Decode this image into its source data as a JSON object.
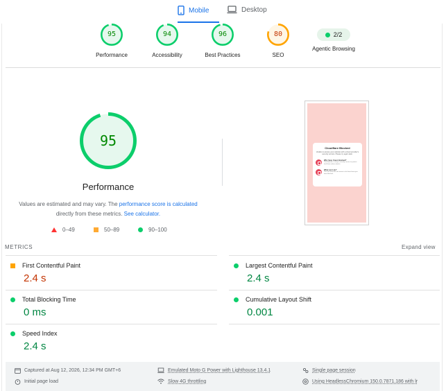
{
  "tabs": {
    "mobile": "Mobile",
    "desktop": "Desktop"
  },
  "categories": [
    {
      "score": "95",
      "label": "Performance",
      "color": "#0cce6b",
      "text_color": "#008800",
      "bg": "#e6f8ee",
      "value": 95
    },
    {
      "score": "94",
      "label": "Accessibility",
      "color": "#0cce6b",
      "text_color": "#008800",
      "bg": "#e6f8ee",
      "value": 94
    },
    {
      "score": "96",
      "label": "Best Practices",
      "color": "#0cce6b",
      "text_color": "#008800",
      "bg": "#e6f8ee",
      "value": 96
    },
    {
      "score": "80",
      "label": "SEO",
      "color": "#ffa400",
      "text_color": "#c33300",
      "bg": "#fff6e5",
      "value": 80
    }
  ],
  "agentic": {
    "score": "2/2",
    "label": "Agentic Browsing"
  },
  "performance": {
    "score": "95",
    "value": 95,
    "title": "Performance",
    "note_start": "Values are estimated and may vary. The ",
    "note_link1": "performance score is calculated",
    "note_mid": "directly from these metrics. ",
    "note_link2": "See calculator."
  },
  "legend": {
    "fail": "0–49",
    "average": "50–89",
    "pass": "90–100"
  },
  "thumbnail": {
    "title": "Cloudflare Blocked",
    "text": "Unable to access your website with a cloud provider's security service. Please try again later.",
    "row1_title": "Why have I been blocked?",
    "row1_text": "This website is using a security service to protect itself from online attacks.",
    "row2_title": "What can I do?",
    "row2_text": "You can email the site owner to let them know you were blocked."
  },
  "metrics": {
    "label": "METRICS",
    "expand": "Expand view",
    "items": [
      {
        "name": "First Contentful Paint",
        "value": "2.4 s",
        "status": "average"
      },
      {
        "name": "Largest Contentful Paint",
        "value": "2.4 s",
        "status": "pass"
      },
      {
        "name": "Total Blocking Time",
        "value": "0 ms",
        "status": "pass"
      },
      {
        "name": "Cumulative Layout Shift",
        "value": "0.001",
        "status": "pass"
      },
      {
        "name": "Speed Index",
        "value": "2.4 s",
        "status": "pass"
      }
    ]
  },
  "footer": {
    "captured": "Captured at Aug 12, 2026, 12:34 PM GMT+6",
    "initial": "Initial page load",
    "emulated": "Emulated Moto G Power with Lighthouse 13.4.1",
    "throttling": "Slow 4G throttling",
    "session": "Single page session",
    "browser": "Using HeadlessChromium 150.0.7871.186 with lr"
  }
}
